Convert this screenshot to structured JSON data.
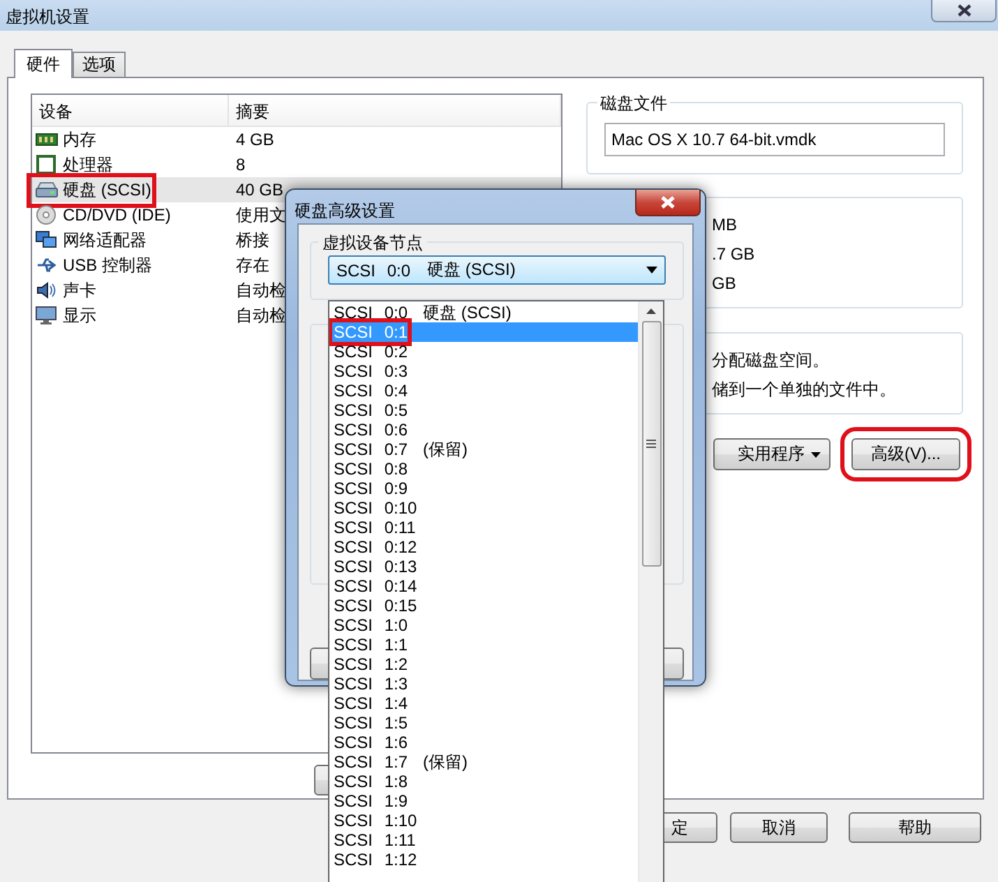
{
  "window": {
    "title": "虚拟机设置"
  },
  "tabs": [
    {
      "label": "硬件",
      "selected": true
    },
    {
      "label": "选项",
      "selected": false
    }
  ],
  "devices": {
    "columns": [
      "设备",
      "摘要"
    ],
    "rows": [
      {
        "kind": "memory",
        "name": "内存",
        "summary": "4 GB",
        "selected": false,
        "marked": false
      },
      {
        "kind": "cpu",
        "name": "处理器",
        "summary": "8",
        "selected": false,
        "marked": false
      },
      {
        "kind": "disk",
        "name": "硬盘 (SCSI)",
        "summary": "40 GB",
        "selected": true,
        "marked": true
      },
      {
        "kind": "cdrom",
        "name": "CD/DVD (IDE)",
        "summary": "使用文",
        "selected": false,
        "marked": false
      },
      {
        "kind": "network",
        "name": "网络适配器",
        "summary": "桥接",
        "selected": false,
        "marked": false
      },
      {
        "kind": "usb",
        "name": "USB 控制器",
        "summary": "存在",
        "selected": false,
        "marked": false
      },
      {
        "kind": "sound",
        "name": "声卡",
        "summary": "自动检",
        "selected": false,
        "marked": false
      },
      {
        "kind": "display",
        "name": "显示",
        "summary": "自动检",
        "selected": false,
        "marked": false
      }
    ]
  },
  "disk_file": {
    "title": "磁盘文件",
    "value": "Mac OS X 10.7 64-bit.vmdk"
  },
  "capacity": {
    "lines": [
      "MB",
      ".7 GB",
      "GB"
    ]
  },
  "allocation": {
    "lines": [
      "分配磁盘空间。",
      "储到一个单独的文件中。"
    ]
  },
  "disk_buttons": [
    {
      "label": "实用程序",
      "menu": true,
      "marked": false
    },
    {
      "label": "高级(V)...",
      "menu": false,
      "marked": true
    }
  ],
  "footer_buttons": [
    "定",
    "取消",
    "帮助"
  ],
  "dialog": {
    "title": "硬盘高级设置",
    "group": "虚拟设备节点",
    "combo": {
      "node": "SCSI 0:0",
      "note": "硬盘 (SCSI)",
      "expanded": true
    },
    "options": [
      {
        "node": "SCSI 0:0",
        "note": "硬盘 (SCSI)",
        "selected": false,
        "marked": false
      },
      {
        "node": "SCSI 0:1",
        "selected": true,
        "marked": true
      },
      {
        "node": "SCSI 0:2",
        "selected": false,
        "marked": false
      },
      {
        "node": "SCSI 0:3",
        "selected": false,
        "marked": false
      },
      {
        "node": "SCSI 0:4",
        "selected": false,
        "marked": false
      },
      {
        "node": "SCSI 0:5",
        "selected": false,
        "marked": false
      },
      {
        "node": "SCSI 0:6",
        "selected": false,
        "marked": false
      },
      {
        "node": "SCSI 0:7",
        "note": "(保留)",
        "selected": false,
        "marked": false
      },
      {
        "node": "SCSI 0:8",
        "selected": false,
        "marked": false
      },
      {
        "node": "SCSI 0:9",
        "selected": false,
        "marked": false
      },
      {
        "node": "SCSI 0:10",
        "selected": false,
        "marked": false
      },
      {
        "node": "SCSI 0:11",
        "selected": false,
        "marked": false
      },
      {
        "node": "SCSI 0:12",
        "selected": false,
        "marked": false
      },
      {
        "node": "SCSI 0:13",
        "selected": false,
        "marked": false
      },
      {
        "node": "SCSI 0:14",
        "selected": false,
        "marked": false
      },
      {
        "node": "SCSI 0:15",
        "selected": false,
        "marked": false
      },
      {
        "node": "SCSI 1:0",
        "selected": false,
        "marked": false
      },
      {
        "node": "SCSI 1:1",
        "selected": false,
        "marked": false
      },
      {
        "node": "SCSI 1:2",
        "selected": false,
        "marked": false
      },
      {
        "node": "SCSI 1:3",
        "selected": false,
        "marked": false
      },
      {
        "node": "SCSI 1:4",
        "selected": false,
        "marked": false
      },
      {
        "node": "SCSI 1:5",
        "selected": false,
        "marked": false
      },
      {
        "node": "SCSI 1:6",
        "selected": false,
        "marked": false
      },
      {
        "node": "SCSI 1:7",
        "note": "(保留)",
        "selected": false,
        "marked": false
      },
      {
        "node": "SCSI 1:8",
        "selected": false,
        "marked": false
      },
      {
        "node": "SCSI 1:9",
        "selected": false,
        "marked": false
      },
      {
        "node": "SCSI 1:10",
        "selected": false,
        "marked": false
      },
      {
        "node": "SCSI 1:11",
        "selected": false,
        "marked": false
      },
      {
        "node": "SCSI 1:12",
        "selected": false,
        "marked": false
      }
    ]
  }
}
